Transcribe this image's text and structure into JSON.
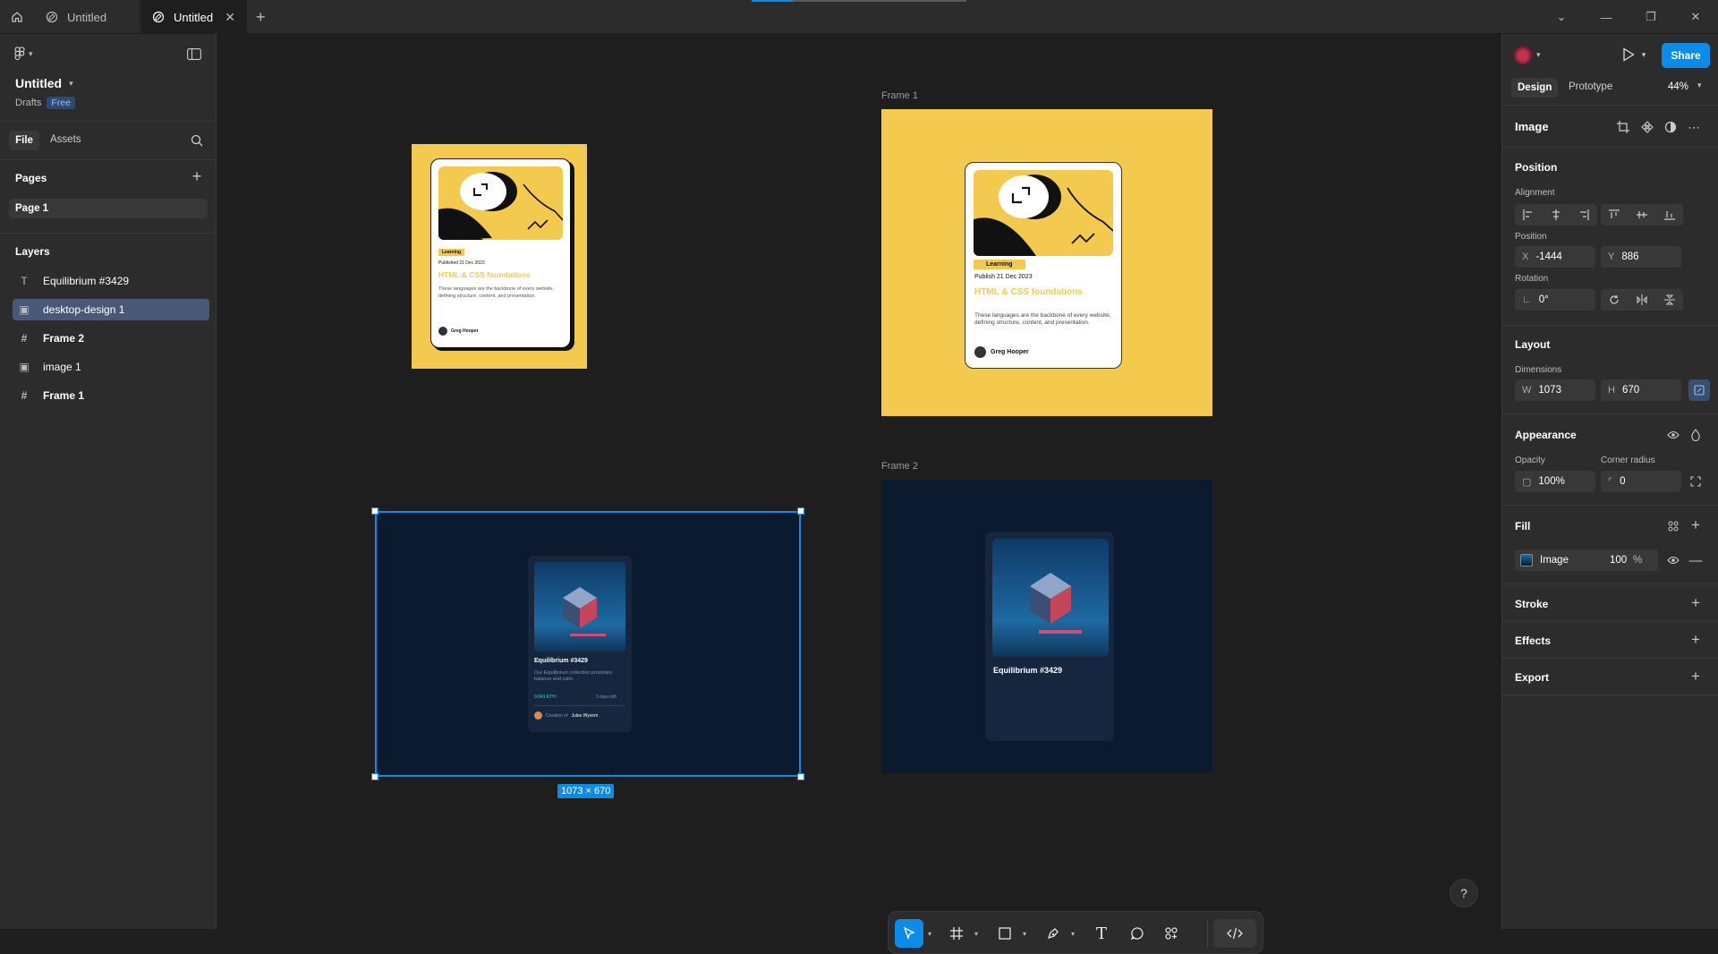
{
  "tabs": [
    {
      "label": "Untitled"
    },
    {
      "label": "Untitled"
    }
  ],
  "left_panel": {
    "file_name": "Untitled",
    "location": "Drafts",
    "plan_badge": "Free",
    "tab_file": "File",
    "tab_assets": "Assets",
    "pages_title": "Pages",
    "page_1": "Page 1",
    "layers_title": "Layers",
    "layers": [
      {
        "label": "Equilibrium #3429",
        "icon": "text-icon",
        "glyph": "T"
      },
      {
        "label": "desktop-design 1",
        "icon": "image-icon",
        "glyph": "▣"
      },
      {
        "label": "Frame 2",
        "icon": "frame-icon",
        "glyph": "#"
      },
      {
        "label": "image 1",
        "icon": "image-icon",
        "glyph": "▣"
      },
      {
        "label": "Frame 1",
        "icon": "frame-icon",
        "glyph": "#"
      }
    ]
  },
  "canvas": {
    "frame1_label": "Frame 1",
    "frame2_label": "Frame 2",
    "size_badge": "1073 × 670",
    "card_small": {
      "tag": "Learning",
      "date": "Published 21 Dec 2023",
      "title": "HTML & CSS foundations",
      "desc": "These languages are the backbone of every website, defining structure, content, and presentation.",
      "author": "Greg Hooper"
    },
    "card_large": {
      "tag": "Learning",
      "date": "Publish 21 Dec 2023",
      "title": "HTML & CSS foundations",
      "desc": "These languages are the backbone of every website, defining structure, content, and presentation.",
      "author": "Greg Hooper"
    },
    "nft_small": {
      "title": "Equilibrium #3429",
      "desc": "Our Equilibrium collection promotes balance and calm.",
      "price": "0.041 ETH",
      "time": "3 days left",
      "creator_prefix": "Creation of",
      "creator": "Jules Wyvern"
    },
    "nft_large": {
      "title": "Equilibrium #3429"
    }
  },
  "right_panel": {
    "share": "Share",
    "tab_design": "Design",
    "tab_prototype": "Prototype",
    "zoom": "44%",
    "selection_type": "Image",
    "position_title": "Position",
    "alignment_label": "Alignment",
    "position_label": "Position",
    "x_label": "X",
    "x_value": "-1444",
    "y_label": "Y",
    "y_value": "886",
    "rotation_label": "Rotation",
    "rotation_value": "0°",
    "layout_title": "Layout",
    "dimensions_label": "Dimensions",
    "w_label": "W",
    "w_value": "1073",
    "h_label": "H",
    "h_value": "670",
    "appearance_title": "Appearance",
    "opacity_label": "Opacity",
    "opacity_value": "100%",
    "corner_label": "Corner radius",
    "corner_value": "0",
    "fill_title": "Fill",
    "fill_type": "Image",
    "fill_opacity": "100",
    "fill_unit": "%",
    "stroke_title": "Stroke",
    "effects_title": "Effects",
    "export_title": "Export"
  },
  "colors": {
    "accent": "#0c8ce9",
    "yellow": "#f3ca4d",
    "navy": "#0b1a2f",
    "selected_layer": "#4a5878"
  }
}
